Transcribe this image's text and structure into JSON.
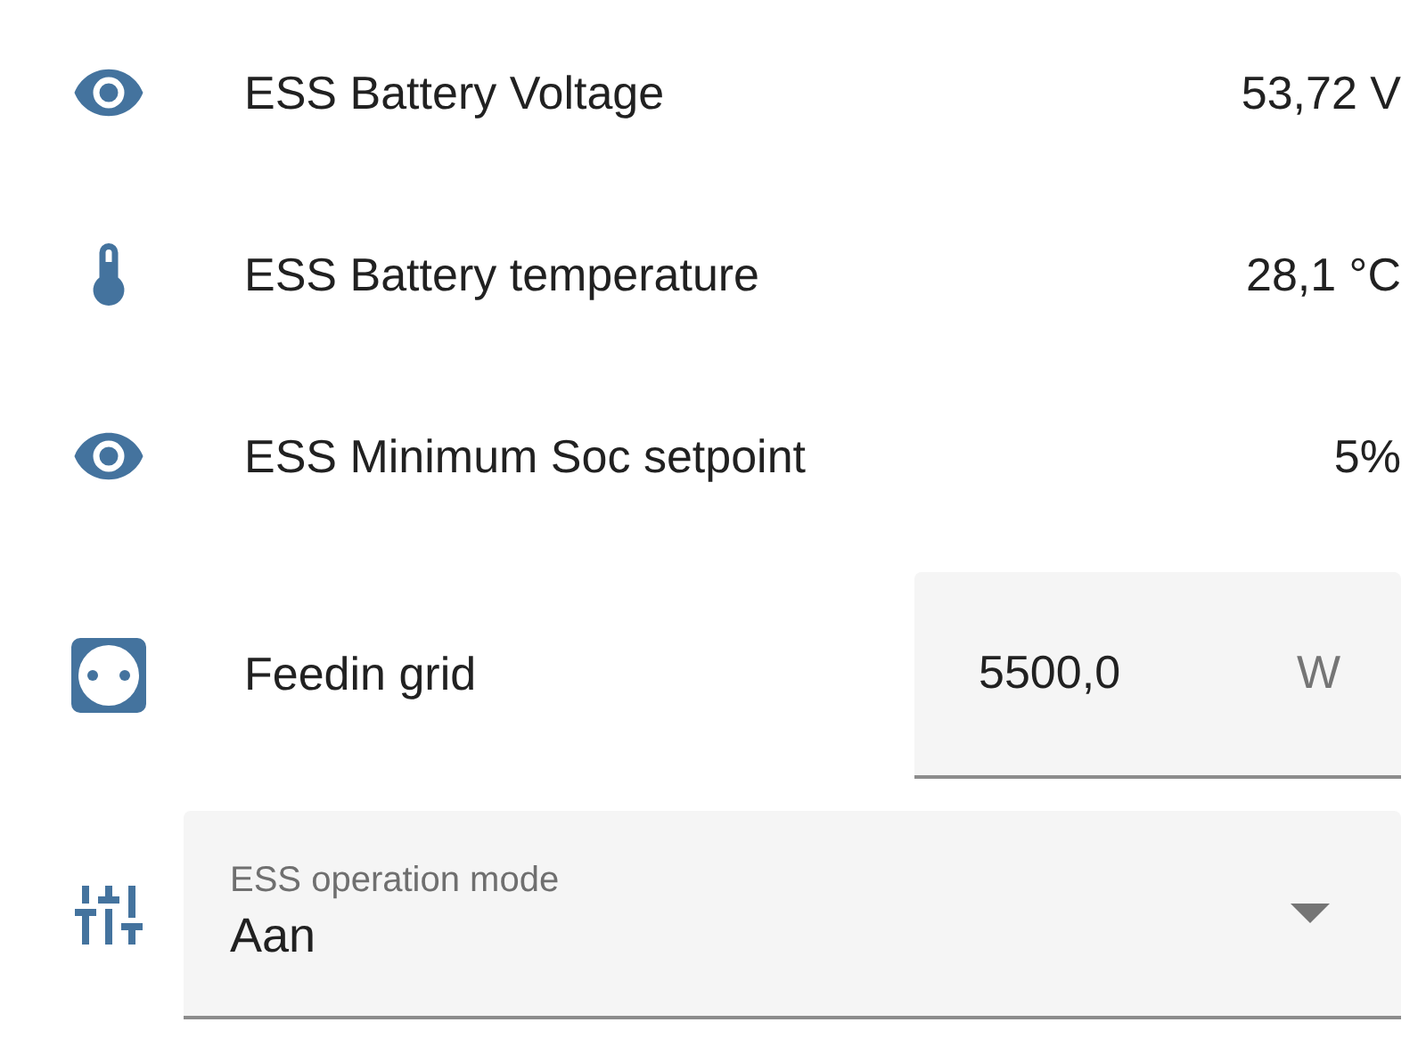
{
  "entities": [
    {
      "kind": "sensor",
      "name": "ESS Battery Voltage",
      "value": "53,72 V"
    },
    {
      "kind": "sensor",
      "name": "ESS Battery temperature",
      "value": "28,1 °C"
    },
    {
      "kind": "sensor",
      "name": "ESS Minimum Soc setpoint",
      "value": "5%"
    },
    {
      "kind": "number",
      "name": "Feedin grid",
      "value": "5500,0",
      "unit": "W"
    },
    {
      "kind": "select",
      "label": "ESS operation mode",
      "value": "Aan"
    }
  ]
}
